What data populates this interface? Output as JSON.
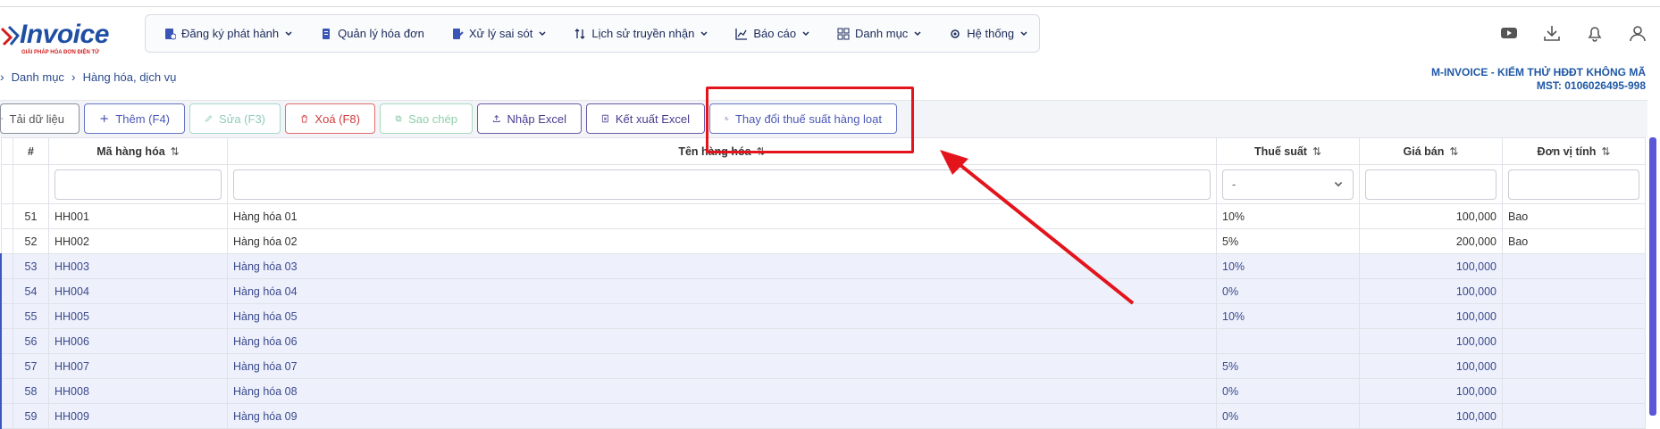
{
  "logo": {
    "text": "Invoice",
    "subtitle": "GIẢI PHÁP HÓA ĐƠN ĐIỆN TỬ"
  },
  "menu": [
    {
      "label": "Đăng ký phát hành",
      "icon": "file-register-icon",
      "has_dropdown": true
    },
    {
      "label": "Quản lý hóa đơn",
      "icon": "file-icon",
      "has_dropdown": false
    },
    {
      "label": "Xử lý sai sót",
      "icon": "file-edit-icon",
      "has_dropdown": true
    },
    {
      "label": "Lịch sử truyền nhận",
      "icon": "sort-arrows-icon",
      "has_dropdown": true
    },
    {
      "label": "Báo cáo",
      "icon": "chart-line-icon",
      "has_dropdown": true
    },
    {
      "label": "Danh mục",
      "icon": "grid-icon",
      "has_dropdown": true
    },
    {
      "label": "Hệ thống",
      "icon": "gear-icon",
      "has_dropdown": true
    }
  ],
  "breadcrumb": {
    "level1": "Danh mục",
    "level2": "Hàng hóa, dịch vụ"
  },
  "company": {
    "name": "M-INVOICE - KIỂM THỬ HĐĐT KHÔNG MÃ",
    "tax_code": "MST: 0106026495-998"
  },
  "toolbar": {
    "reload": "Tải dữ liệu",
    "add": "Thêm (F4)",
    "edit": "Sửa (F3)",
    "delete": "Xoá (F8)",
    "copy": "Sao chép",
    "import": "Nhập Excel",
    "export": "Kết xuất Excel",
    "bulk_tax": "Thay đổi thuế suất hàng loạt"
  },
  "table": {
    "columns": {
      "index": "#",
      "code": "Mã hàng hóa",
      "name": "Tên hàng hóa",
      "tax": "Thuế suất",
      "price": "Giá bán",
      "unit": "Đơn vị tính"
    },
    "tax_filter_value": "-",
    "rows": [
      {
        "index": "51",
        "code": "HH001",
        "name": "Hàng hóa 01",
        "tax": "10%",
        "price": "100,000",
        "unit": "Bao"
      },
      {
        "index": "52",
        "code": "HH002",
        "name": "Hàng hóa 02",
        "tax": "5%",
        "price": "200,000",
        "unit": "Bao"
      },
      {
        "index": "53",
        "code": "HH003",
        "name": "Hàng hóa 03",
        "tax": "10%",
        "price": "100,000",
        "unit": ""
      },
      {
        "index": "54",
        "code": "HH004",
        "name": "Hàng hóa 04",
        "tax": "0%",
        "price": "100,000",
        "unit": ""
      },
      {
        "index": "55",
        "code": "HH005",
        "name": "Hàng hóa 05",
        "tax": "10%",
        "price": "100,000",
        "unit": ""
      },
      {
        "index": "56",
        "code": "HH006",
        "name": "Hàng hóa 06",
        "tax": "",
        "price": "100,000",
        "unit": ""
      },
      {
        "index": "57",
        "code": "HH007",
        "name": "Hàng hóa 07",
        "tax": "5%",
        "price": "100,000",
        "unit": ""
      },
      {
        "index": "58",
        "code": "HH008",
        "name": "Hàng hóa 08",
        "tax": "0%",
        "price": "100,000",
        "unit": ""
      },
      {
        "index": "59",
        "code": "HH009",
        "name": "Hàng hóa 09",
        "tax": "0%",
        "price": "100,000",
        "unit": ""
      }
    ]
  },
  "colors": {
    "brand": "#1f4fa3",
    "accent": "#4a57b5",
    "highlight": "#e3141c",
    "selected_row": "#eef0fb"
  }
}
